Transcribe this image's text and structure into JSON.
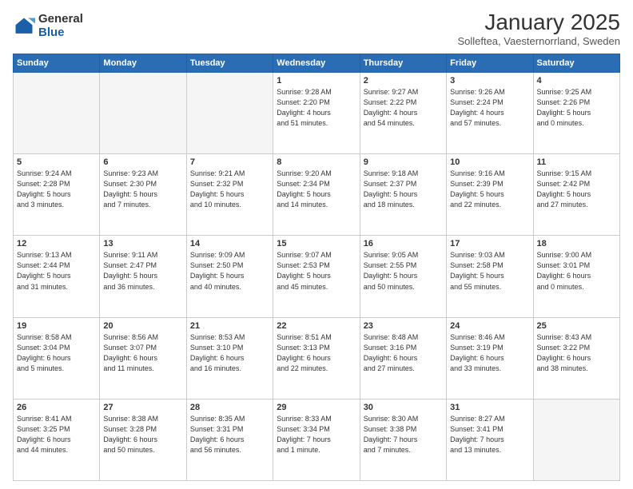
{
  "logo": {
    "general": "General",
    "blue": "Blue"
  },
  "title": "January 2025",
  "subtitle": "Solleftea, Vaesternorrland, Sweden",
  "headers": [
    "Sunday",
    "Monday",
    "Tuesday",
    "Wednesday",
    "Thursday",
    "Friday",
    "Saturday"
  ],
  "weeks": [
    [
      {
        "day": "",
        "info": ""
      },
      {
        "day": "",
        "info": ""
      },
      {
        "day": "",
        "info": ""
      },
      {
        "day": "1",
        "info": "Sunrise: 9:28 AM\nSunset: 2:20 PM\nDaylight: 4 hours\nand 51 minutes."
      },
      {
        "day": "2",
        "info": "Sunrise: 9:27 AM\nSunset: 2:22 PM\nDaylight: 4 hours\nand 54 minutes."
      },
      {
        "day": "3",
        "info": "Sunrise: 9:26 AM\nSunset: 2:24 PM\nDaylight: 4 hours\nand 57 minutes."
      },
      {
        "day": "4",
        "info": "Sunrise: 9:25 AM\nSunset: 2:26 PM\nDaylight: 5 hours\nand 0 minutes."
      }
    ],
    [
      {
        "day": "5",
        "info": "Sunrise: 9:24 AM\nSunset: 2:28 PM\nDaylight: 5 hours\nand 3 minutes."
      },
      {
        "day": "6",
        "info": "Sunrise: 9:23 AM\nSunset: 2:30 PM\nDaylight: 5 hours\nand 7 minutes."
      },
      {
        "day": "7",
        "info": "Sunrise: 9:21 AM\nSunset: 2:32 PM\nDaylight: 5 hours\nand 10 minutes."
      },
      {
        "day": "8",
        "info": "Sunrise: 9:20 AM\nSunset: 2:34 PM\nDaylight: 5 hours\nand 14 minutes."
      },
      {
        "day": "9",
        "info": "Sunrise: 9:18 AM\nSunset: 2:37 PM\nDaylight: 5 hours\nand 18 minutes."
      },
      {
        "day": "10",
        "info": "Sunrise: 9:16 AM\nSunset: 2:39 PM\nDaylight: 5 hours\nand 22 minutes."
      },
      {
        "day": "11",
        "info": "Sunrise: 9:15 AM\nSunset: 2:42 PM\nDaylight: 5 hours\nand 27 minutes."
      }
    ],
    [
      {
        "day": "12",
        "info": "Sunrise: 9:13 AM\nSunset: 2:44 PM\nDaylight: 5 hours\nand 31 minutes."
      },
      {
        "day": "13",
        "info": "Sunrise: 9:11 AM\nSunset: 2:47 PM\nDaylight: 5 hours\nand 36 minutes."
      },
      {
        "day": "14",
        "info": "Sunrise: 9:09 AM\nSunset: 2:50 PM\nDaylight: 5 hours\nand 40 minutes."
      },
      {
        "day": "15",
        "info": "Sunrise: 9:07 AM\nSunset: 2:53 PM\nDaylight: 5 hours\nand 45 minutes."
      },
      {
        "day": "16",
        "info": "Sunrise: 9:05 AM\nSunset: 2:55 PM\nDaylight: 5 hours\nand 50 minutes."
      },
      {
        "day": "17",
        "info": "Sunrise: 9:03 AM\nSunset: 2:58 PM\nDaylight: 5 hours\nand 55 minutes."
      },
      {
        "day": "18",
        "info": "Sunrise: 9:00 AM\nSunset: 3:01 PM\nDaylight: 6 hours\nand 0 minutes."
      }
    ],
    [
      {
        "day": "19",
        "info": "Sunrise: 8:58 AM\nSunset: 3:04 PM\nDaylight: 6 hours\nand 5 minutes."
      },
      {
        "day": "20",
        "info": "Sunrise: 8:56 AM\nSunset: 3:07 PM\nDaylight: 6 hours\nand 11 minutes."
      },
      {
        "day": "21",
        "info": "Sunrise: 8:53 AM\nSunset: 3:10 PM\nDaylight: 6 hours\nand 16 minutes."
      },
      {
        "day": "22",
        "info": "Sunrise: 8:51 AM\nSunset: 3:13 PM\nDaylight: 6 hours\nand 22 minutes."
      },
      {
        "day": "23",
        "info": "Sunrise: 8:48 AM\nSunset: 3:16 PM\nDaylight: 6 hours\nand 27 minutes."
      },
      {
        "day": "24",
        "info": "Sunrise: 8:46 AM\nSunset: 3:19 PM\nDaylight: 6 hours\nand 33 minutes."
      },
      {
        "day": "25",
        "info": "Sunrise: 8:43 AM\nSunset: 3:22 PM\nDaylight: 6 hours\nand 38 minutes."
      }
    ],
    [
      {
        "day": "26",
        "info": "Sunrise: 8:41 AM\nSunset: 3:25 PM\nDaylight: 6 hours\nand 44 minutes."
      },
      {
        "day": "27",
        "info": "Sunrise: 8:38 AM\nSunset: 3:28 PM\nDaylight: 6 hours\nand 50 minutes."
      },
      {
        "day": "28",
        "info": "Sunrise: 8:35 AM\nSunset: 3:31 PM\nDaylight: 6 hours\nand 56 minutes."
      },
      {
        "day": "29",
        "info": "Sunrise: 8:33 AM\nSunset: 3:34 PM\nDaylight: 7 hours\nand 1 minute."
      },
      {
        "day": "30",
        "info": "Sunrise: 8:30 AM\nSunset: 3:38 PM\nDaylight: 7 hours\nand 7 minutes."
      },
      {
        "day": "31",
        "info": "Sunrise: 8:27 AM\nSunset: 3:41 PM\nDaylight: 7 hours\nand 13 minutes."
      },
      {
        "day": "",
        "info": ""
      }
    ]
  ]
}
